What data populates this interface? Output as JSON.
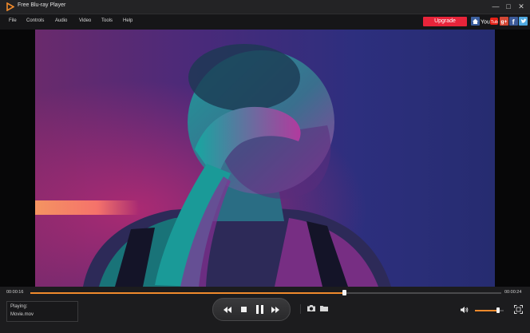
{
  "app": {
    "title": "Free Blu-ray Player"
  },
  "window_controls": {
    "minimize": "—",
    "maximize": "□",
    "close": "✕"
  },
  "menu": {
    "items": [
      "File",
      "Controls",
      "Audio",
      "Video",
      "Tools",
      "Help"
    ]
  },
  "header": {
    "upgrade_label": "Upgrade",
    "social_icons": [
      "home-icon",
      "youtube-icon",
      "google-plus-icon",
      "facebook-icon",
      "twitter-icon"
    ],
    "social_texts": {
      "youtube": "You Tube",
      "google_plus": "g+",
      "facebook": "f"
    }
  },
  "player": {
    "current_time": "00:00:16",
    "total_time": "00:00:24",
    "progress": 0.666,
    "volume": 0.8,
    "playing_label": "Playing:",
    "file_name": "Movie.mov"
  },
  "colors": {
    "accent": "#f08a2c",
    "upgrade": "#e8243a",
    "background": "#1c1c1e"
  }
}
